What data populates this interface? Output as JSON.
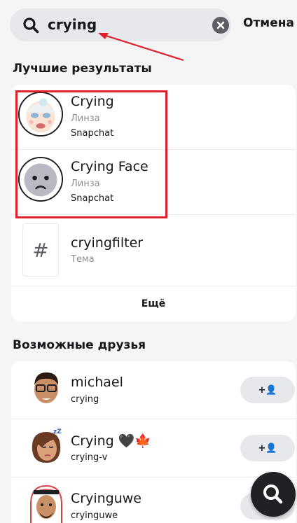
{
  "search": {
    "query": "crying",
    "cancel_label": "Отмена"
  },
  "best_results": {
    "title": "Лучшие результаты",
    "items": [
      {
        "title": "Crying",
        "type": "Линза",
        "creator": "Snapchat"
      },
      {
        "title": "Crying Face",
        "type": "Линза",
        "creator": "Snapchat"
      },
      {
        "title": "cryingfilter",
        "type": "Тема"
      }
    ],
    "more_label": "Ещё"
  },
  "friends": {
    "title": "Возможные друзья",
    "items": [
      {
        "name": "michael",
        "username": "crying"
      },
      {
        "name": "Crying 🖤🍁",
        "username": "crying-v"
      },
      {
        "name": "Cryinguwe",
        "username": "cryinguwe"
      }
    ],
    "add_label": "+👤"
  },
  "colors": {
    "highlight": "#e0202a",
    "background": "#f4f5f7",
    "fab": "#1f2124"
  }
}
